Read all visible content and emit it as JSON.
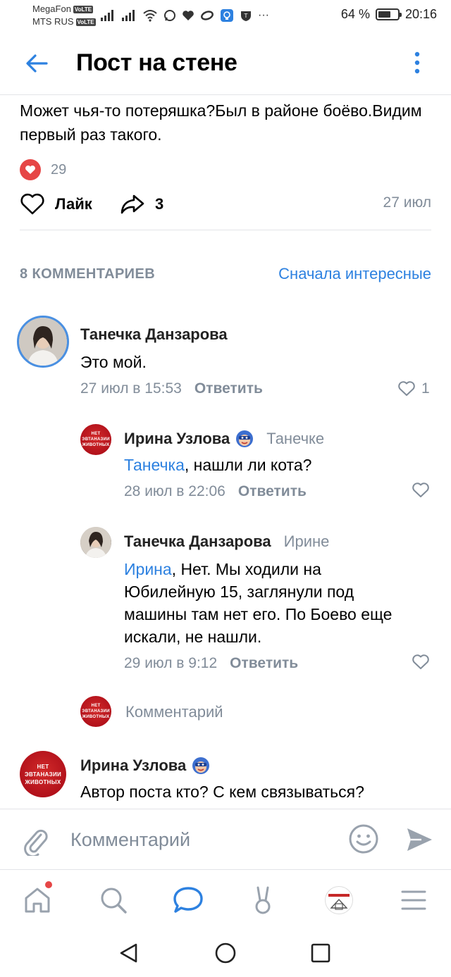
{
  "status_bar": {
    "carrier1": "MegaFon",
    "carrier2": "MTS RUS",
    "volte": "VoLTE",
    "battery_text": "64 %",
    "battery_level": 0.64,
    "time": "20:16",
    "more": "···"
  },
  "header": {
    "title": "Пост на стене"
  },
  "post": {
    "text": "Может чья-то потеряшка?Был в районе боёво.Видим первый раз такого.",
    "reaction_count": "29",
    "like_label": "Лайк",
    "share_count": "3",
    "date": "27 июл"
  },
  "comments_section": {
    "count_label": "8 КОММЕНТАРИЕВ",
    "sort_label": "Сначала интересные"
  },
  "org_avatar_text": {
    "line1": "НЕТ",
    "line2": "ЭВТАНАЗИИ",
    "line3": "ЖИВОТНЫХ"
  },
  "comments": [
    {
      "author": "Танечка Данзарова",
      "text": "Это мой.",
      "date": "27 июл в 15:53",
      "reply_label": "Ответить",
      "likes": "1"
    },
    {
      "author": "Ирина Узлова",
      "reply_to": "Танечке",
      "mention": "Танечка",
      "text": ", нашли ли кота?",
      "date": "28 июл в 22:06",
      "reply_label": "Ответить"
    },
    {
      "author": "Танечка Данзарова",
      "reply_to": "Ирине",
      "mention": "Ирина",
      "text": ", Нет. Мы ходили на Юбилейную 15, заглянули под машины там нет его. По Боево еще искали, не нашли.",
      "date": "29 июл в 9:12",
      "reply_label": "Ответить"
    },
    {
      "author": "Ирина Узлова",
      "text": "Автор поста кто? С кем связываться?"
    }
  ],
  "inline_reply": {
    "placeholder": "Комментарий"
  },
  "comment_bar": {
    "placeholder": "Комментарий"
  },
  "colors": {
    "accent": "#2d81e0",
    "secondary_text": "#818c99",
    "like_red": "#e64646",
    "separator": "#e3e4e8"
  },
  "icons": {
    "back": "arrow-left-icon",
    "menu": "more-vertical-icon",
    "like": "heart-outline-icon",
    "share": "share-arrow-icon",
    "attach": "paperclip-icon",
    "emoji": "smile-icon",
    "send": "send-icon",
    "tabs": [
      "home-icon",
      "search-icon",
      "messages-icon",
      "services-icon",
      "profile-icon",
      "menu-icon"
    ]
  }
}
